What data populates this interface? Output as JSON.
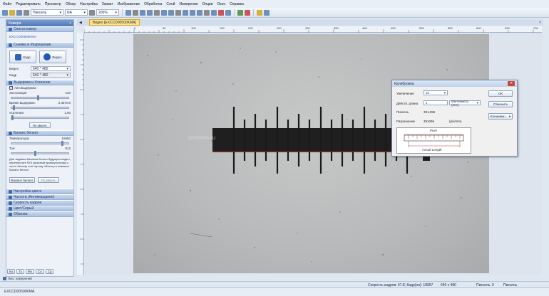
{
  "menu": [
    "Файл",
    "Редактировать",
    "Просмотр",
    "Обзор",
    "Настройка",
    "Захват",
    "Изображение",
    "Обработка",
    "Слой",
    "Измерения",
    "Опции",
    "Окно",
    "Справка"
  ],
  "toolbar": {
    "pen_select": "Пиксель",
    "na_select": "NA",
    "zoom_select": "200%"
  },
  "left_panel": {
    "title": "Камера",
    "camera_list_label": "Список камер",
    "camera_name": "EXCCD00500KMA",
    "capture_section": "Съемка и Разрешение",
    "snap_label": "Кадр",
    "video_label": "Видео",
    "video_res_label": "Видео",
    "video_res_value": "640 * 480",
    "frame_label": "Кадр",
    "frame_value": "640 * 480",
    "exposure_section": "Выдержка и Усиление",
    "auto_exposure_label": "Автовыдержка",
    "exposure_target_label": "Экспозиция",
    "exposure_target_value": "120",
    "exposure_time_label": "Время выдержки:",
    "exposure_time_value": "2,367ms",
    "gain_label": "Усиление:",
    "gain_value": "1,00",
    "default_button": "По умолч.",
    "white_balance_section": "Баланс белого",
    "temperature_label": "Температура:",
    "temperature_value": "15650",
    "tint_label": "Тон:",
    "tint_value": "812",
    "wb_help_text": "Для задания баланса белого будущего видео, переместите ROI (красный прямоугольник) к чисто белому или серому объекту и нажмите Баланс белого",
    "wb_button": "Баланс белого",
    "wb_default_button": "По умолч.",
    "collapsed_sections": [
      "Настройка цвета",
      "Частота (Антимерцание)",
      "Скорость кадров",
      "Цвет/Серый",
      "Обрезка"
    ]
  },
  "tab": {
    "title": "Видео [EXCCD00500KMA]"
  },
  "ruler_ticks": [
    "0",
    "50",
    "100",
    "150",
    "200",
    "250",
    "300",
    "350",
    "400",
    "450",
    "500",
    "550",
    "600",
    "650",
    "700"
  ],
  "watermark": "sturman.ru",
  "dialog": {
    "title": "Калибровка",
    "zoom_label": "Увеличение",
    "zoom_value": "10",
    "actual_length_label": "Действ. длина",
    "actual_length_value": "1",
    "unit_value": "Миллиметр (mm)",
    "pixel_label": "Пиксель",
    "pixel_value": "391,096",
    "resolution_label": "Разрешение",
    "resolution_value": "391096",
    "resolution_unit": "(pix/mm)",
    "ok_button": "OK",
    "cancel_button": "Отменить",
    "color_button": "Концевик...",
    "diagram_top_label": "Pixel",
    "diagram_bottom_label": "Actual Length"
  },
  "status": {
    "speed": "Скорость кадров: 67.8; Кадр(ов): 18967",
    "resolution": "640 x 480",
    "pixels": "Пиксель: 0",
    "unit": "Пиксель"
  },
  "bottom_tabs": [
    "Лист измерений"
  ],
  "camera_tabs": [
    "Ка",
    "Ту",
    "Фи",
    "Сл",
    "Ср"
  ],
  "bottom_camera": "EXCCD00500KMA"
}
